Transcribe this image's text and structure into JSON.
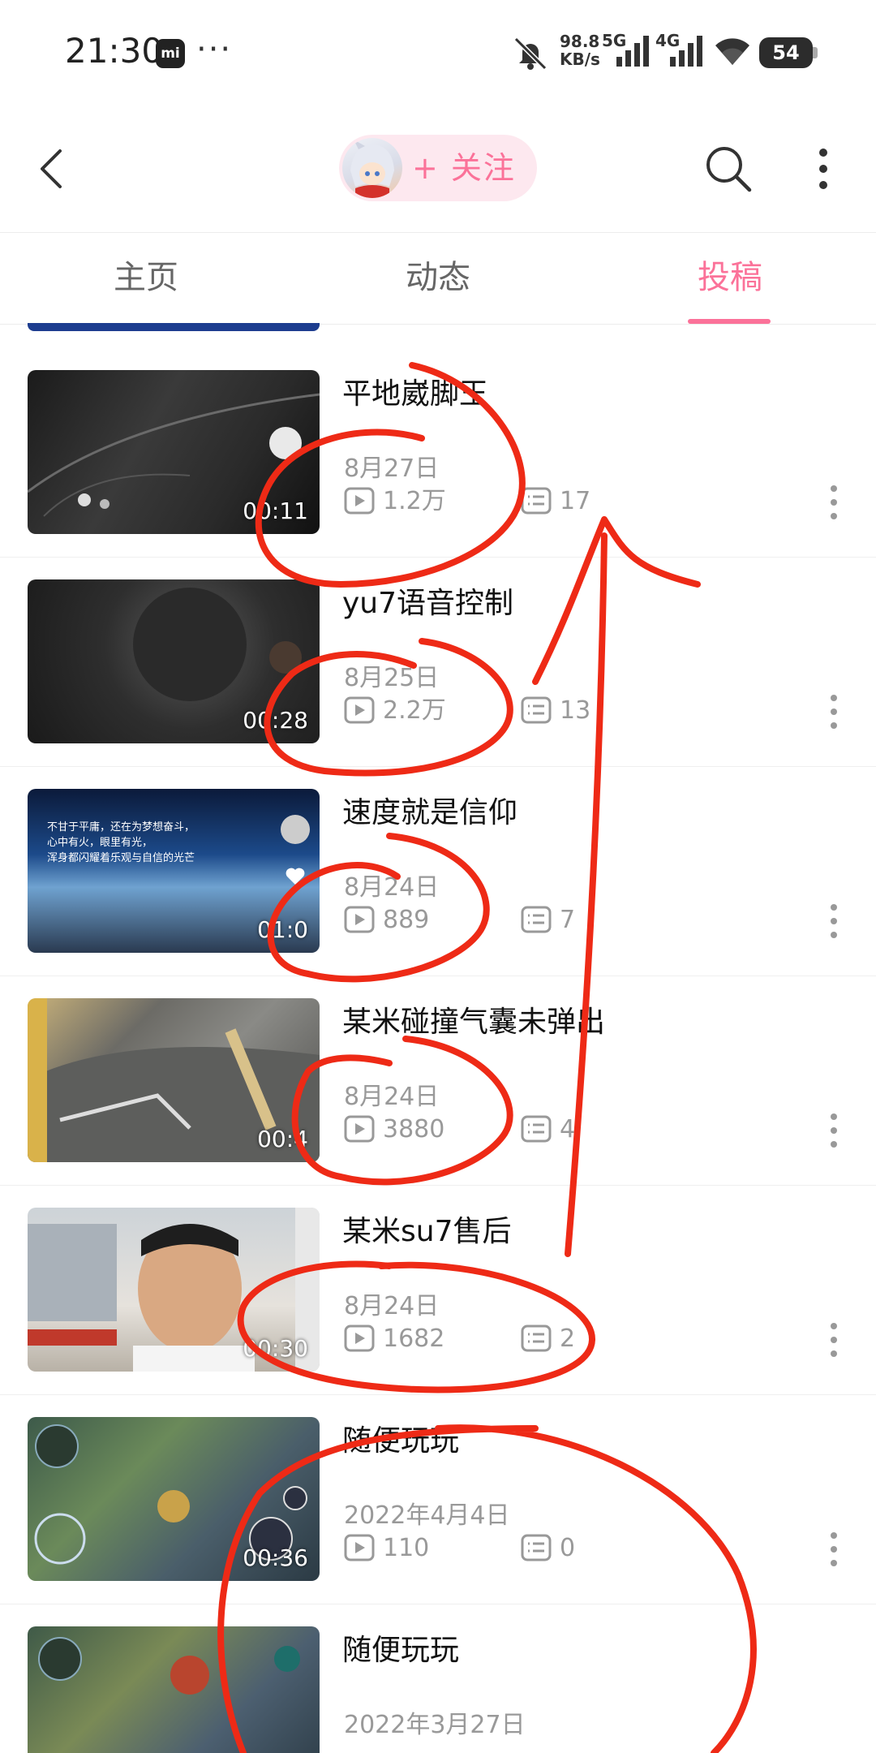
{
  "status_bar": {
    "time": "21:30",
    "mi_badge": "mi",
    "more_dots": "···",
    "net_speed_value": "98.8",
    "net_speed_unit": "KB/s",
    "signal_1_label": "5G",
    "signal_2_label": "4G",
    "battery": "54",
    "icons": [
      "bell-muted-icon",
      "signal-icon",
      "wifi-icon",
      "battery-icon"
    ]
  },
  "header": {
    "follow_label": "+ 关注",
    "icons": [
      "back-icon",
      "avatar",
      "search-icon",
      "more-vertical-icon"
    ]
  },
  "tabs": [
    {
      "label": "主页",
      "active": false
    },
    {
      "label": "动态",
      "active": false
    },
    {
      "label": "投稿",
      "active": true
    }
  ],
  "videos": [
    {
      "title": "平地崴脚王",
      "date": "8月27日",
      "views": "1.2万",
      "comments": "17",
      "duration": "00:11"
    },
    {
      "title": "yu7语音控制",
      "date": "8月25日",
      "views": "2.2万",
      "comments": "13",
      "duration": "00:28"
    },
    {
      "title": "速度就是信仰",
      "date": "8月24日",
      "views": "889",
      "comments": "7",
      "duration": "01:0"
    },
    {
      "title": "某米碰撞气囊未弹出",
      "date": "8月24日",
      "views": "3880",
      "comments": "4",
      "duration": "00:4"
    },
    {
      "title": "某米su7售后",
      "date": "8月24日",
      "views": "1682",
      "comments": "2",
      "duration": "00:30"
    },
    {
      "title": "随便玩玩",
      "date": "2022年4月4日",
      "views": "110",
      "comments": "0",
      "duration": "00:36"
    },
    {
      "title": "随便玩玩",
      "date": "2022年3月27日",
      "views": "",
      "comments": "",
      "duration": ""
    }
  ],
  "thumbnail_overlays": {
    "video_3_caption_line1": "不甘于平庸，还在为梦想奋斗，",
    "video_3_caption_line2": "心中有火，眼里有光，",
    "video_3_caption_line3": "浑身都闪耀着乐观与自信的光芒"
  },
  "colors": {
    "accent": "#fb7299",
    "follow_bg": "#fde8ef",
    "scribble": "#ee2a16",
    "meta_gray": "#999999"
  }
}
